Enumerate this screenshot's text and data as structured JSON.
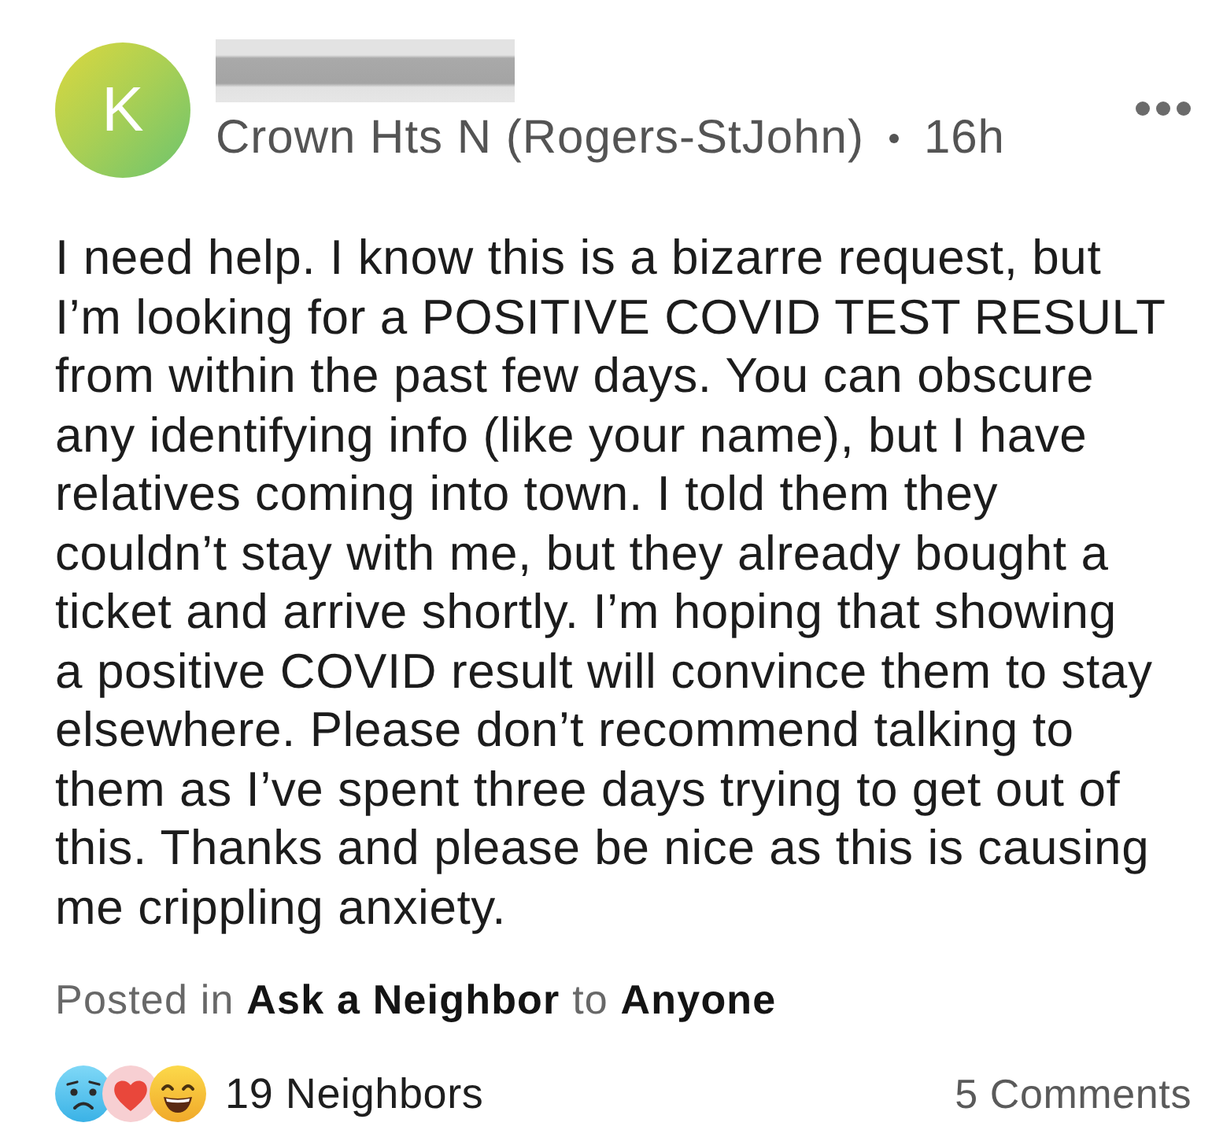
{
  "post": {
    "avatar": {
      "letter": "K"
    },
    "neighborhood": "Crown Hts N (Rogers-StJohn)",
    "time": "16h",
    "body": "I need help. I know this is a bizarre request, but\nI’m looking for a POSITIVE COVID TEST RESULT\nfrom within the past few days. You can obscure\nany identifying info (like your name), but I have\nrelatives coming into town. I told them they\ncouldn’t stay with me, but they already bought a\nticket and arrive shortly. I’m hoping that showing\na positive COVID result will convince them to stay\nelsewhere. Please don’t recommend talking to\nthem as I’ve spent three days trying to get out of\nthis. Thanks and please be nice as this is causing\nme crippling anxiety.",
    "posted_in": "Posted in **Ask a Neighbor** to **Anyone**"
  },
  "footer": {
    "reactions": [
      {
        "kind": "sad"
      },
      {
        "kind": "heart"
      },
      {
        "kind": "laugh"
      }
    ],
    "reactions_count": "19 Neighbors",
    "comments": "5 Comments"
  }
}
